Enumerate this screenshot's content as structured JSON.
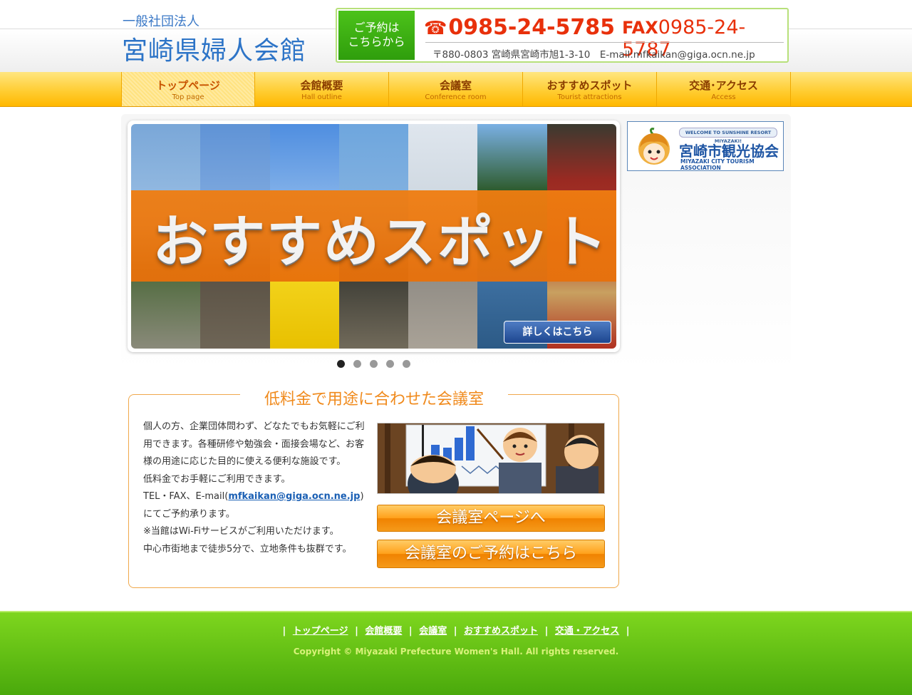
{
  "header": {
    "org_prefix": "一般社団法人",
    "org_name": "宮崎県婦人会館",
    "reserve_line1": "ご予約は",
    "reserve_line2": "こちらから",
    "tel_icon": "☎",
    "tel": "0985-24-5785",
    "fax_label": "FAX",
    "fax": "0985-24-5787",
    "address": "〒880-0803 宮崎県宮崎市旭1-3-10　E-mail:mfkaikan@giga.ocn.ne.jp"
  },
  "nav": [
    {
      "jp": "トップページ",
      "en": "Top page"
    },
    {
      "jp": "会館概要",
      "en": "Hall outline"
    },
    {
      "jp": "会議室",
      "en": "Conference room"
    },
    {
      "jp": "おすすめスポット",
      "en": "Tourist attractions"
    },
    {
      "jp": "交通･アクセス",
      "en": "Access"
    }
  ],
  "slider": {
    "title": "おすすめスポット",
    "more_button": "詳しくはこちら"
  },
  "tourism": {
    "welcome": "WELCOME TO SUNSHINE RESORT MIYAZAKI!",
    "title": "宮崎市観光協会",
    "sub": "MIYAZAKI CITY TOURISM ASSOCIATION"
  },
  "conference": {
    "heading": "低料金で用途に合わせた会議室",
    "p1": "個人の方、企業団体問わず、どなたでもお気軽にご利用できます。各種研修や勉強会・面接会場など、お客様の用途に応じた目的に使える便利な施設です。",
    "p2": "低料金でお手軽にご利用できます。",
    "p3_before": "TEL・FAX、E-mail(",
    "p3_email": "mfkaikan@giga.ocn.ne.jp",
    "p3_after": ")にてご予約承ります。",
    "p4": "※当館はWi-Fiサービスがご利用いただけます。",
    "p5": "中心市街地まで徒歩5分で、立地条件も抜群です。",
    "btn_page": "会議室ページへ",
    "btn_reserve": "会議室のご予約はこちら"
  },
  "footer": {
    "links": [
      "トップページ",
      "会館概要",
      "会議室",
      "おすすめスポット",
      "交通・アクセス"
    ],
    "copyright": "Copyright © Miyazaki Prefecture Women's Hall. All rights reserved."
  }
}
